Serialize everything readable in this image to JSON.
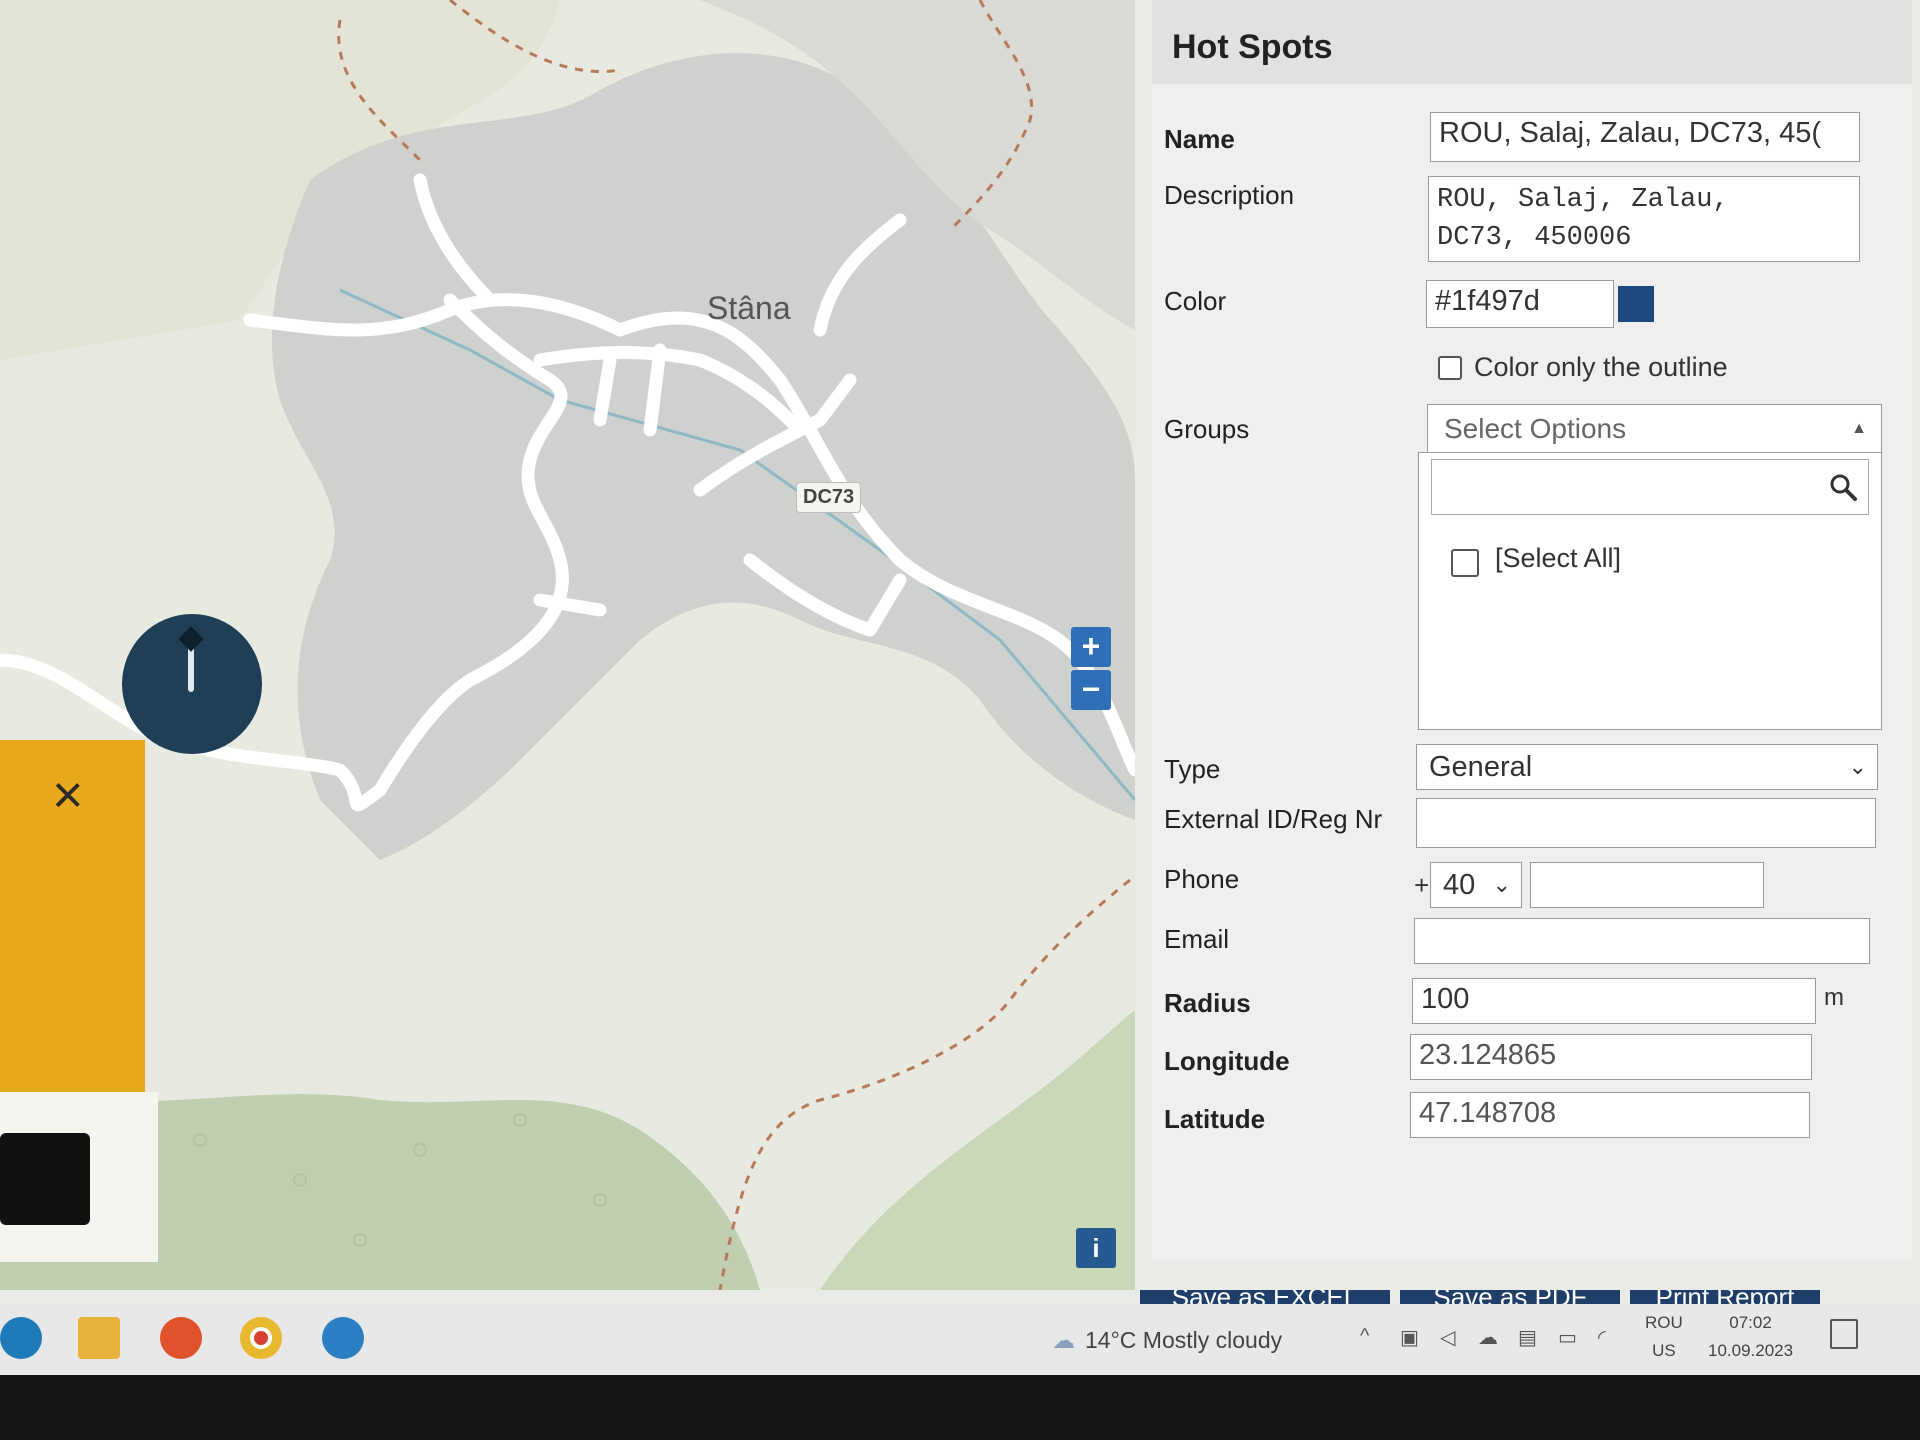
{
  "map": {
    "place_label": "Stâna",
    "road_label": "DC73",
    "zoom_in": "+",
    "zoom_out": "−",
    "info": "i",
    "close": "×"
  },
  "panel": {
    "title": "Hot Spots",
    "name_label": "Name",
    "name_value": "ROU, Salaj, Zalau, DC73, 45(",
    "description_label": "Description",
    "description_value": "ROU, Salaj, Zalau,\nDC73, 450006",
    "color_label": "Color",
    "color_value": "#1f497d",
    "color_outline_label": "Color only the outline",
    "groups_label": "Groups",
    "groups_placeholder": "Select Options",
    "select_all_label": "[Select All]",
    "type_label": "Type",
    "type_value": "General",
    "external_id_label": "External ID/Reg Nr",
    "phone_label": "Phone",
    "phone_plus": "+",
    "phone_code": "40",
    "email_label": "Email",
    "radius_label": "Radius",
    "radius_value": "100",
    "radius_unit": "m",
    "longitude_label": "Longitude",
    "longitude_value": "23.124865",
    "latitude_label": "Latitude",
    "latitude_value": "47.148708"
  },
  "footer": {
    "save_excel": "Save as EXCEL",
    "save_pdf": "Save as PDF",
    "print_report": "Print Report"
  },
  "taskbar": {
    "weather": "14°C  Mostly cloudy",
    "lang_top": "ROU",
    "lang_bottom": "US",
    "time": "07:02",
    "date": "10.09.2023"
  },
  "colors": {
    "hotspot_color": "#1f497d",
    "accent_blue": "#2e6fb8",
    "warning_yellow": "#e9a91d"
  }
}
